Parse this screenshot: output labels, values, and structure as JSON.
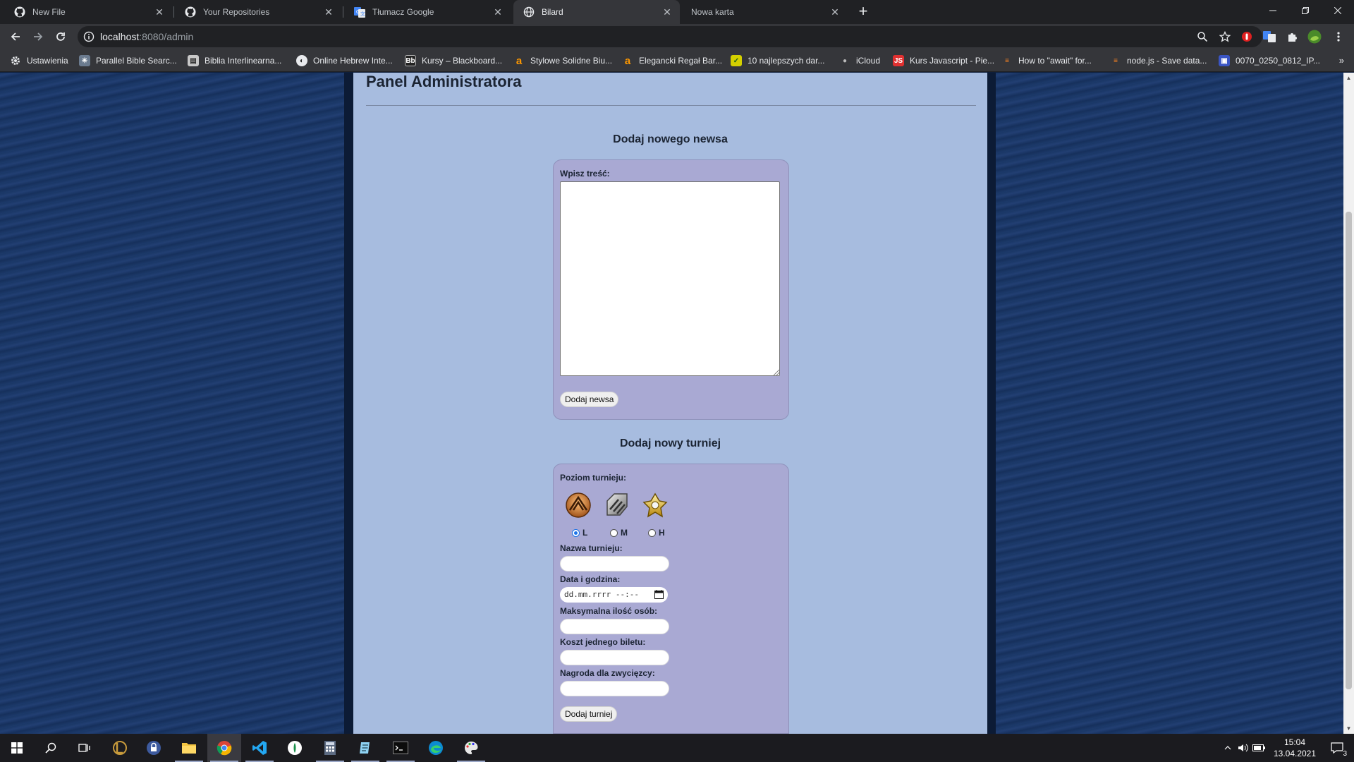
{
  "browser": {
    "tabs": [
      {
        "title": "New File",
        "icon": "github-icon",
        "active": false
      },
      {
        "title": "Your Repositories",
        "icon": "github-icon",
        "active": false
      },
      {
        "title": "Tłumacz Google",
        "icon": "google-translate-icon",
        "active": false
      },
      {
        "title": "Bilard",
        "icon": "globe-icon",
        "active": true
      },
      {
        "title": "Nowa karta",
        "icon": "",
        "active": false
      }
    ],
    "url_host": "localhost",
    "url_rest": ":8080/admin",
    "bookmarks": [
      {
        "label": "Ustawienia",
        "icon": "gear-icon"
      },
      {
        "label": "Parallel Bible Searc...",
        "icon": "bible-icon"
      },
      {
        "label": "Biblia Interlinearna...",
        "icon": "book-icon"
      },
      {
        "label": "Online Hebrew Inte...",
        "icon": "globe-icon"
      },
      {
        "label": "Kursy – Blackboard...",
        "icon": "blackboard-icon"
      },
      {
        "label": "Stylowe Solidne Biu...",
        "icon": "amazon-icon"
      },
      {
        "label": "Elegancki Regał Bar...",
        "icon": "amazon-icon"
      },
      {
        "label": "10 najlepszych dar...",
        "icon": "check-icon"
      },
      {
        "label": "iCloud",
        "icon": "apple-icon"
      },
      {
        "label": "Kurs Javascript - Pie...",
        "icon": "js-icon"
      },
      {
        "label": "How to \"await\" for...",
        "icon": "stackoverflow-icon"
      },
      {
        "label": "node.js - Save data...",
        "icon": "stackoverflow-icon"
      },
      {
        "label": "0070_0250_0812_IP...",
        "icon": "doc-icon"
      }
    ]
  },
  "page": {
    "title": "Panel Administratora",
    "news": {
      "heading": "Dodaj nowego newsa",
      "content_label": "Wpisz treść:",
      "content_value": "",
      "submit_label": "Dodaj newsa"
    },
    "tournament": {
      "heading": "Dodaj nowy turniej",
      "level_label": "Poziom turnieju:",
      "levels": [
        {
          "value": "L",
          "label": "L",
          "checked": true,
          "icon": "bronze-rank-icon"
        },
        {
          "value": "M",
          "label": "M",
          "checked": false,
          "icon": "silver-rank-icon"
        },
        {
          "value": "H",
          "label": "H",
          "checked": false,
          "icon": "gold-rank-icon"
        }
      ],
      "name_label": "Nazwa turnieju:",
      "name_value": "",
      "date_label": "Data i godzina:",
      "date_placeholder": "dd.mm.rrrr --:--",
      "max_label": "Maksymalna ilość osób:",
      "max_value": "",
      "cost_label": "Koszt jednego biletu:",
      "cost_value": "",
      "prize_label": "Nagroda dla zwycięzcy:",
      "prize_value": "",
      "submit_label": "Dodaj turniej"
    }
  },
  "taskbar": {
    "time": "15:04",
    "date": "13.04.2021",
    "notifications": "3"
  },
  "colors": {
    "panel": "#a7bcdf",
    "form": "#a9a9d3",
    "accent": "#1a73e8"
  }
}
